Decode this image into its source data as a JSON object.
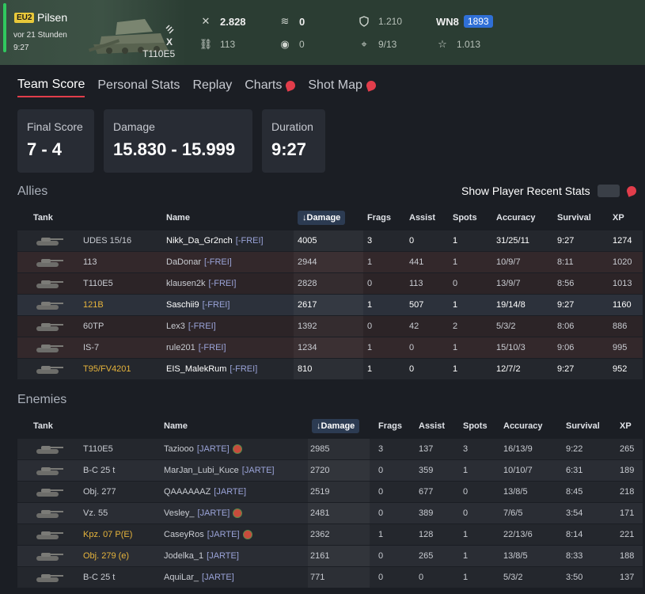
{
  "header": {
    "region": "EU2",
    "map": "Pilsen",
    "time_ago": "vor 21 Stunden",
    "duration": "9:27",
    "tank": "T110E5",
    "tier_mark": "X",
    "stats_row1": [
      {
        "icon": "frags-icon",
        "value": "2.828"
      },
      {
        "icon": "spotting-icon",
        "value": "0"
      },
      {
        "icon": "shield-icon",
        "value": "1.210"
      },
      {
        "label": "WN8",
        "badge": "1893"
      }
    ],
    "stats_row2": [
      {
        "icon": "track-icon",
        "value": "113"
      },
      {
        "icon": "eye-icon",
        "value": "0"
      },
      {
        "icon": "crosshair-icon",
        "value": "9/13"
      },
      {
        "icon": "star-icon",
        "value": "1.013"
      }
    ]
  },
  "tabs": [
    "Team Score",
    "Personal Stats",
    "Replay",
    "Charts",
    "Shot Map"
  ],
  "cards": [
    {
      "label": "Final Score",
      "value": "7 - 4"
    },
    {
      "label": "Damage",
      "value": "15.830 - 15.999"
    },
    {
      "label": "Duration",
      "value": "9:27"
    }
  ],
  "allies_title": "Allies",
  "recent_label": "Show Player Recent Stats",
  "enemies_title": "Enemies",
  "columns": [
    "Tank",
    "Name",
    "Damage",
    "Frags",
    "Assist",
    "Spots",
    "Accuracy",
    "Survival",
    "XP"
  ],
  "allies": [
    {
      "tank": "UDES 15/16",
      "name": "Nikk_Da_Gr2nch",
      "clan": "[-FREI]",
      "damage": "4005",
      "frags": "3",
      "assist": "0",
      "spots": "1",
      "accuracy": "31/25/11",
      "survival": "9:27",
      "xp": "1274",
      "alive": true,
      "gold": false
    },
    {
      "tank": "113",
      "name": "DaDonar",
      "clan": "[-FREI]",
      "damage": "2944",
      "frags": "1",
      "assist": "441",
      "spots": "1",
      "accuracy": "10/9/7",
      "survival": "8:11",
      "xp": "1020",
      "alive": false,
      "gold": false
    },
    {
      "tank": "T110E5",
      "name": "klausen2k",
      "clan": "[-FREI]",
      "damage": "2828",
      "frags": "0",
      "assist": "113",
      "spots": "0",
      "accuracy": "13/9/7",
      "survival": "8:56",
      "xp": "1013",
      "alive": false,
      "gold": false
    },
    {
      "tank": "121B",
      "name": "Saschii9",
      "clan": "[-FREI]",
      "damage": "2617",
      "frags": "1",
      "assist": "507",
      "spots": "1",
      "accuracy": "19/14/8",
      "survival": "9:27",
      "xp": "1160",
      "alive": true,
      "gold": true
    },
    {
      "tank": "60TP",
      "name": "Lex3",
      "clan": "[-FREI]",
      "damage": "1392",
      "frags": "0",
      "assist": "42",
      "spots": "2",
      "accuracy": "5/3/2",
      "survival": "8:06",
      "xp": "886",
      "alive": false,
      "gold": false
    },
    {
      "tank": "IS-7",
      "name": "rule201",
      "clan": "[-FREI]",
      "damage": "1234",
      "frags": "1",
      "assist": "0",
      "spots": "1",
      "accuracy": "15/10/3",
      "survival": "9:06",
      "xp": "995",
      "alive": false,
      "gold": false
    },
    {
      "tank": "T95/FV4201",
      "name": "EIS_MalekRum",
      "clan": "[-FREI]",
      "damage": "810",
      "frags": "1",
      "assist": "0",
      "spots": "1",
      "accuracy": "12/7/2",
      "survival": "9:27",
      "xp": "952",
      "alive": true,
      "gold": true
    }
  ],
  "enemies": [
    {
      "tank": "T110E5",
      "name": "Taziooo",
      "clan": "[JARTE]",
      "flag": true,
      "damage": "2985",
      "frags": "3",
      "assist": "137",
      "spots": "3",
      "accuracy": "16/13/9",
      "survival": "9:22",
      "xp": "265",
      "gold": false
    },
    {
      "tank": "B-C 25 t",
      "name": "MarJan_Lubi_Kuce",
      "clan": "[JARTE]",
      "flag": false,
      "damage": "2720",
      "frags": "0",
      "assist": "359",
      "spots": "1",
      "accuracy": "10/10/7",
      "survival": "6:31",
      "xp": "189",
      "gold": false
    },
    {
      "tank": "Obj. 277",
      "name": "QAAAAAAZ",
      "clan": "[JARTE]",
      "flag": false,
      "damage": "2519",
      "frags": "0",
      "assist": "677",
      "spots": "0",
      "accuracy": "13/8/5",
      "survival": "8:45",
      "xp": "218",
      "gold": false
    },
    {
      "tank": "Vz. 55",
      "name": "Vesley_",
      "clan": "[JARTE]",
      "flag": true,
      "damage": "2481",
      "frags": "0",
      "assist": "389",
      "spots": "0",
      "accuracy": "7/6/5",
      "survival": "3:54",
      "xp": "171",
      "gold": false
    },
    {
      "tank": "Kpz. 07 P(E)",
      "name": "CaseyRos",
      "clan": "[JARTE]",
      "flag": true,
      "damage": "2362",
      "frags": "1",
      "assist": "128",
      "spots": "1",
      "accuracy": "22/13/6",
      "survival": "8:14",
      "xp": "221",
      "gold": true
    },
    {
      "tank": "Obj. 279 (e)",
      "name": "Jodelka_1",
      "clan": "[JARTE]",
      "flag": false,
      "damage": "2161",
      "frags": "0",
      "assist": "265",
      "spots": "1",
      "accuracy": "13/8/5",
      "survival": "8:33",
      "xp": "188",
      "gold": true
    },
    {
      "tank": "B-C 25 t",
      "name": "AquiLar_",
      "clan": "[JARTE]",
      "flag": false,
      "damage": "771",
      "frags": "0",
      "assist": "0",
      "spots": "1",
      "accuracy": "5/3/2",
      "survival": "3:50",
      "xp": "137",
      "gold": false
    }
  ],
  "colors": {
    "accent_red": "#e23d4b",
    "header_green": "#2b3d33",
    "wn8_blue": "#2f6fd6",
    "gold": "#e6b43c"
  }
}
